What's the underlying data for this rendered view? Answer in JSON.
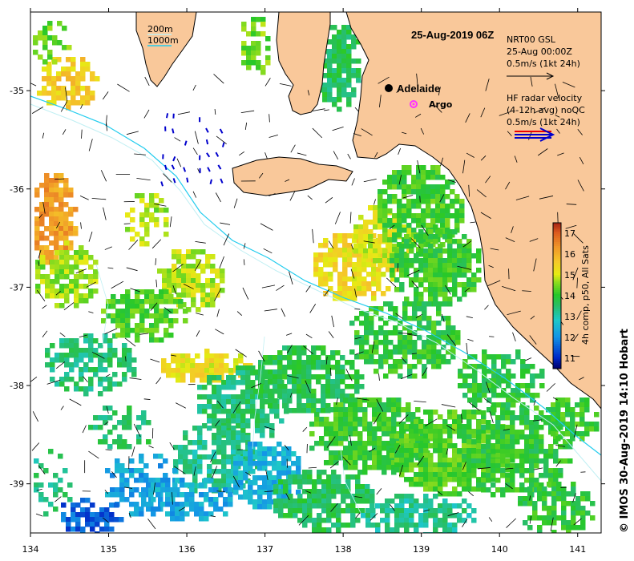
{
  "title": "25-Aug-2019 06Z",
  "copyright": "© IMOS 30-Aug-2019 14:10 Hobart",
  "depth_legend": {
    "line1": "200m",
    "line2": "1000m"
  },
  "nrt_legend": {
    "line1": "NRT00 GSL",
    "line2": "25-Aug 00:00Z",
    "line3": "0.5m/s (1kt 24h)"
  },
  "hf_legend": {
    "line1": "HF radar velocity",
    "line2": "(4-12h avg) noQC",
    "line3": "0.5m/s (1kt 24h)"
  },
  "places": {
    "adelaide": "Adelaide",
    "argo": "Argo"
  },
  "colorbar": {
    "label": "4h comp, p50, All Sats",
    "ticks": [
      "11",
      "12",
      "13",
      "14",
      "15",
      "16",
      "17"
    ],
    "range": [
      10.5,
      17.5
    ]
  },
  "chart_data": {
    "type": "heatmap",
    "x_ticks": [
      "134",
      "135",
      "136",
      "137",
      "138",
      "139",
      "140",
      "141"
    ],
    "y_ticks": [
      "-35",
      "-36",
      "-37",
      "-38",
      "-39"
    ],
    "xlim": [
      134,
      141.3
    ],
    "ylim": [
      -39.5,
      -34.2
    ]
  },
  "colors": {
    "land": "#f9c89a",
    "isobath_200": "#bfeff3",
    "isobath_1000": "#22ccee",
    "hf_red": "#ee0000",
    "hf_blue": "#0000cc",
    "argo": "#ff33ff"
  }
}
